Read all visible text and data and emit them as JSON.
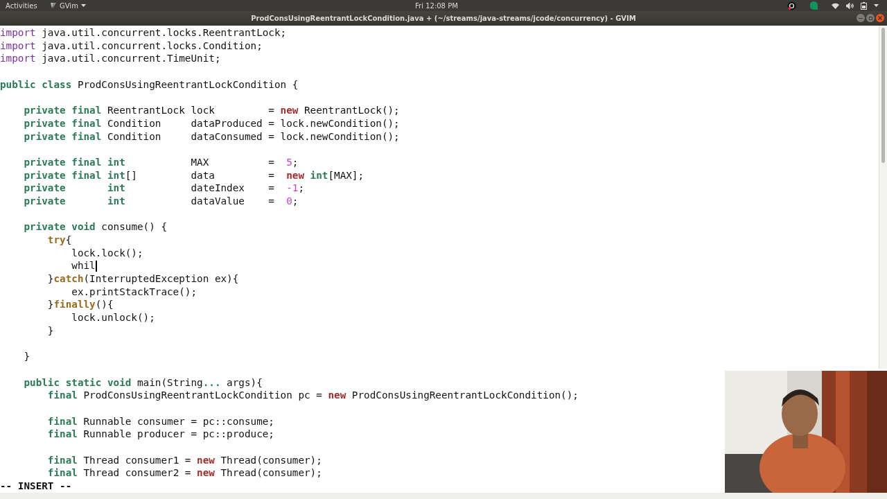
{
  "top_bar": {
    "activities": "Activities",
    "app_menu": "GVim",
    "clock": "Fri 12:08 PM"
  },
  "window": {
    "title": "ProdConsUsingReentrantLockCondition.java + (~/streams/java-streams/jcode/concurrency) - GVIM"
  },
  "editor": {
    "lines": [
      {
        "kind": "code",
        "cursor": false,
        "segments": [
          {
            "kind": "import",
            "text": "import"
          },
          {
            "kind": "plain",
            "text": " java.util.concurrent.locks.ReentrantLock;"
          }
        ]
      },
      {
        "kind": "code",
        "cursor": false,
        "segments": [
          {
            "kind": "import",
            "text": "import"
          },
          {
            "kind": "plain",
            "text": " java.util.concurrent.locks.Condition;"
          }
        ]
      },
      {
        "kind": "code",
        "cursor": false,
        "segments": [
          {
            "kind": "import",
            "text": "import"
          },
          {
            "kind": "plain",
            "text": " java.util.concurrent.TimeUnit;"
          }
        ]
      },
      {
        "kind": "blank"
      },
      {
        "kind": "code",
        "cursor": false,
        "segments": [
          {
            "kind": "keyword",
            "text": "public class"
          },
          {
            "kind": "plain",
            "text": " ProdConsUsingReentrantLockCondition {"
          }
        ]
      },
      {
        "kind": "blank"
      },
      {
        "kind": "code",
        "cursor": false,
        "segments": [
          {
            "kind": "keyword",
            "text": "    private final"
          },
          {
            "kind": "plain",
            "text": " ReentrantLock lock         = "
          },
          {
            "kind": "new",
            "text": "new"
          },
          {
            "kind": "plain",
            "text": " ReentrantLock();"
          }
        ]
      },
      {
        "kind": "code",
        "cursor": false,
        "segments": [
          {
            "kind": "keyword",
            "text": "    private final"
          },
          {
            "kind": "plain",
            "text": " Condition     dataProduced = lock.newCondition();"
          }
        ]
      },
      {
        "kind": "code",
        "cursor": false,
        "segments": [
          {
            "kind": "keyword",
            "text": "    private final"
          },
          {
            "kind": "plain",
            "text": " Condition     dataConsumed = lock.newCondition();"
          }
        ]
      },
      {
        "kind": "blank"
      },
      {
        "kind": "code",
        "cursor": false,
        "segments": [
          {
            "kind": "keyword",
            "text": "    private final int"
          },
          {
            "kind": "plain",
            "text": "           MAX          =  "
          },
          {
            "kind": "number",
            "text": "5"
          },
          {
            "kind": "plain",
            "text": ";"
          }
        ]
      },
      {
        "kind": "code",
        "cursor": false,
        "segments": [
          {
            "kind": "keyword",
            "text": "    private final int"
          },
          {
            "kind": "plain",
            "text": "[]         data         =  "
          },
          {
            "kind": "new",
            "text": "new"
          },
          {
            "kind": "keyword",
            "text": " int"
          },
          {
            "kind": "plain",
            "text": "[MAX];"
          }
        ]
      },
      {
        "kind": "code",
        "cursor": false,
        "segments": [
          {
            "kind": "keyword",
            "text": "    private       int"
          },
          {
            "kind": "plain",
            "text": "           dateIndex    =  "
          },
          {
            "kind": "number",
            "text": "-1"
          },
          {
            "kind": "plain",
            "text": ";"
          }
        ]
      },
      {
        "kind": "code",
        "cursor": false,
        "segments": [
          {
            "kind": "keyword",
            "text": "    private       int"
          },
          {
            "kind": "plain",
            "text": "           dataValue    =  "
          },
          {
            "kind": "number",
            "text": "0"
          },
          {
            "kind": "plain",
            "text": ";"
          }
        ]
      },
      {
        "kind": "blank"
      },
      {
        "kind": "code",
        "cursor": false,
        "segments": [
          {
            "kind": "keyword",
            "text": "    private void"
          },
          {
            "kind": "plain",
            "text": " consume() {"
          }
        ]
      },
      {
        "kind": "code",
        "cursor": false,
        "segments": [
          {
            "kind": "exception",
            "text": "        try"
          },
          {
            "kind": "plain",
            "text": "{"
          }
        ]
      },
      {
        "kind": "code",
        "cursor": false,
        "segments": [
          {
            "kind": "plain",
            "text": "            lock.lock();"
          }
        ]
      },
      {
        "kind": "code",
        "cursor": true,
        "segments": [
          {
            "kind": "plain",
            "text": "            whil"
          }
        ]
      },
      {
        "kind": "code",
        "cursor": false,
        "segments": [
          {
            "kind": "plain",
            "text": "        }"
          },
          {
            "kind": "exception",
            "text": "catch"
          },
          {
            "kind": "plain",
            "text": "(InterruptedException ex){"
          }
        ]
      },
      {
        "kind": "code",
        "cursor": false,
        "segments": [
          {
            "kind": "plain",
            "text": "            ex.printStackTrace();"
          }
        ]
      },
      {
        "kind": "code",
        "cursor": false,
        "segments": [
          {
            "kind": "plain",
            "text": "        }"
          },
          {
            "kind": "exception",
            "text": "finally"
          },
          {
            "kind": "plain",
            "text": "(){"
          }
        ]
      },
      {
        "kind": "code",
        "cursor": false,
        "segments": [
          {
            "kind": "plain",
            "text": "            lock.unlock();"
          }
        ]
      },
      {
        "kind": "code",
        "cursor": false,
        "segments": [
          {
            "kind": "plain",
            "text": "        }"
          }
        ]
      },
      {
        "kind": "blank"
      },
      {
        "kind": "code",
        "cursor": false,
        "segments": [
          {
            "kind": "plain",
            "text": "    }"
          }
        ]
      },
      {
        "kind": "blank"
      },
      {
        "kind": "code",
        "cursor": false,
        "segments": [
          {
            "kind": "keyword",
            "text": "    public static void"
          },
          {
            "kind": "plain",
            "text": " main(String"
          },
          {
            "kind": "keyword",
            "text": "..."
          },
          {
            "kind": "plain",
            "text": " args){"
          }
        ]
      },
      {
        "kind": "code",
        "cursor": false,
        "segments": [
          {
            "kind": "keyword",
            "text": "        final"
          },
          {
            "kind": "plain",
            "text": " ProdConsUsingReentrantLockCondition pc = "
          },
          {
            "kind": "new",
            "text": "new"
          },
          {
            "kind": "plain",
            "text": " ProdConsUsingReentrantLockCondition();"
          }
        ]
      },
      {
        "kind": "blank"
      },
      {
        "kind": "code",
        "cursor": false,
        "segments": [
          {
            "kind": "keyword",
            "text": "        final"
          },
          {
            "kind": "plain",
            "text": " Runnable consumer = pc::consume;"
          }
        ]
      },
      {
        "kind": "code",
        "cursor": false,
        "segments": [
          {
            "kind": "keyword",
            "text": "        final"
          },
          {
            "kind": "plain",
            "text": " Runnable producer = pc::produce;"
          }
        ]
      },
      {
        "kind": "blank"
      },
      {
        "kind": "code",
        "cursor": false,
        "segments": [
          {
            "kind": "keyword",
            "text": "        final"
          },
          {
            "kind": "plain",
            "text": " Thread consumer1 = "
          },
          {
            "kind": "new",
            "text": "new"
          },
          {
            "kind": "plain",
            "text": " Thread(consumer);"
          }
        ]
      },
      {
        "kind": "code",
        "cursor": false,
        "segments": [
          {
            "kind": "keyword",
            "text": "        final"
          },
          {
            "kind": "plain",
            "text": " Thread consumer2 = "
          },
          {
            "kind": "new",
            "text": "new"
          },
          {
            "kind": "plain",
            "text": " Thread(consumer);"
          }
        ]
      }
    ]
  },
  "mode_line": "-- INSERT --"
}
